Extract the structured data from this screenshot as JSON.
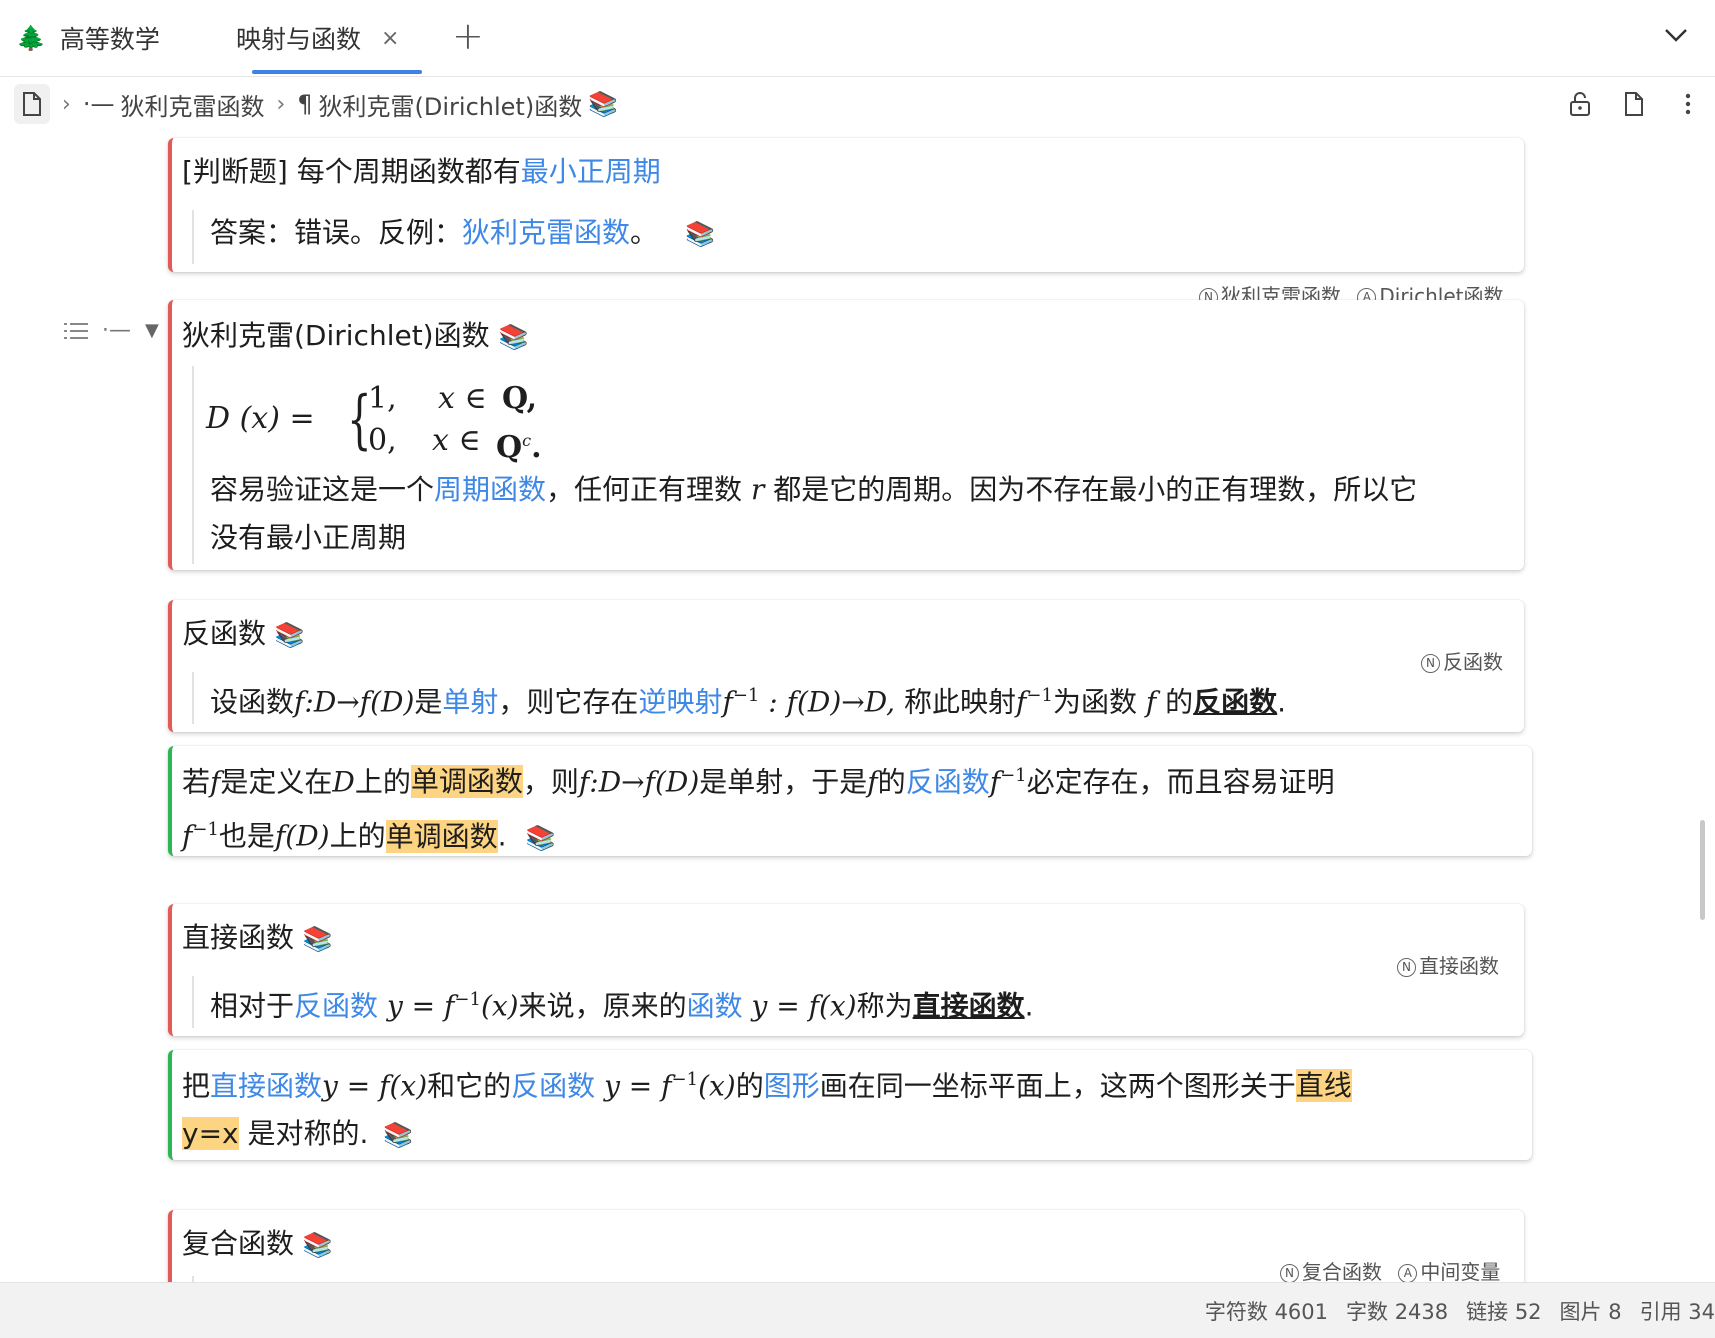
{
  "tabs": [
    {
      "label": "高等数学",
      "icon": "tree-icon"
    },
    {
      "label": "映射与函数",
      "icon": "close-icon",
      "active": true
    }
  ],
  "breadcrumb": {
    "item1_prefix": "⋅—",
    "item1": "狄利克雷函数",
    "item2_prefix": "¶",
    "item2": "狄利克雷(Dirichlet)函数"
  },
  "block1": {
    "prefix": "[判断题] 每个周期函数都有",
    "link": "最小正周期",
    "answer_prefix": "答案：错误。反例：",
    "answer_link": "狄利克雷函数",
    "answer_suffix": "。",
    "refs": [
      "狄利克雷函数",
      "Dirichlet函数"
    ]
  },
  "block2": {
    "title": "狄利克雷(Dirichlet)函数",
    "formula_lhs": "D (x) =",
    "case1_val": "1,",
    "case1_cond_x": "x ∈",
    "case1_set": "Q",
    "case2_val": "0,",
    "case2_cond_x": "x ∈",
    "case2_set": "Q",
    "case2_sup": "c",
    "line1_a": "容易验证这是一个",
    "line1_link": "周期函数",
    "line1_b": "，任何正有理数",
    "line1_var": "r",
    "line1_c": "都是它的周期。因为不存在最小的正有理数，所以它",
    "line2": "没有最小正周期"
  },
  "block3": {
    "title": "反函数",
    "refs": [
      "反函数"
    ],
    "t1": "设函数",
    "m1": "f:D→f(D)",
    "t2": "是",
    "l1": "单射",
    "t3": "，则它存在",
    "l2": "逆映射",
    "m2": "f",
    "sup": "−1",
    "m3": " : f(D)→D,",
    "t4": "称此映射",
    "m4": "f",
    "t5": "为函数",
    "m5": "f",
    "t6": "的",
    "bold": "反函数",
    "end": "."
  },
  "block4": {
    "t1": "若",
    "m1": "f",
    "t2": "是定义在",
    "m2": "D",
    "t3": "上的",
    "h1": "单调函数",
    "t4": "，则",
    "m3": "f:D→f(D)",
    "t5": "是单射，于是",
    "m4": "f",
    "t6": "的",
    "l1": "反函数",
    "m5": "f",
    "sup": "−1",
    "t7": "必定存在，而且容易证明",
    "m6": "f",
    "t8": "也是",
    "m7": "f(D)",
    "t9": "上的",
    "h2": "单调函数",
    "end": "."
  },
  "block5": {
    "title": "直接函数",
    "refs": [
      "直接函数"
    ],
    "t1": "相对于",
    "l1": "反函数",
    "m1": "y = f",
    "sup": "−1",
    "m2": "(x)",
    "t2": "来说，原来的",
    "l2": "函数",
    "m3": "y = f(x)",
    "t3": "称为",
    "bold": "直接函数",
    "end": "."
  },
  "block6": {
    "t1": "把",
    "l1": "直接函数",
    "m1": "y = f(x)",
    "t2": "和它的",
    "l2": "反函数",
    "m2": "y = f",
    "sup": "−1",
    "m3": "(x)",
    "t3": "的",
    "l3": "图形",
    "t4": "画在同一坐标平面上，这两个图形关于",
    "h1": "直线",
    "h2": "y=x",
    "t5": " 是对称的."
  },
  "block7": {
    "title": "复合函数",
    "refs": [
      "复合函数",
      "中间变量"
    ]
  },
  "status": {
    "chars": "字符数 4601",
    "words": "字数 2438",
    "links": "链接 52",
    "images": "图片 8",
    "refs": "引用 34"
  },
  "colors": {
    "accent": "#3d82e4",
    "link": "#3f88e6",
    "highlight": "#fdd582",
    "red_bar": "#e25b58",
    "green_bar": "#2db653"
  }
}
